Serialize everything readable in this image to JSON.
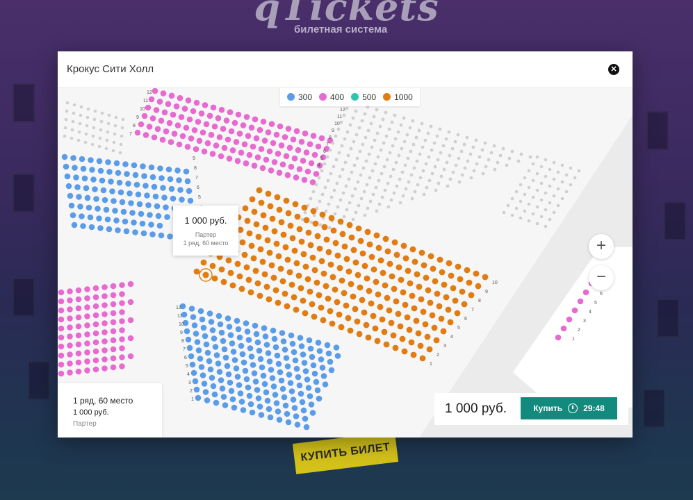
{
  "brand": {
    "logo_text": "qTickets",
    "subtitle": "билетная система"
  },
  "banner": {
    "label": "КУПИТЬ БИЛЕТ"
  },
  "modal": {
    "title": "Крокус Сити Холл",
    "close_icon": "close-icon"
  },
  "legend": [
    {
      "price": "300",
      "color": "#5a9ce8"
    },
    {
      "price": "400",
      "color": "#e86ad0"
    },
    {
      "price": "500",
      "color": "#2cc6ae"
    },
    {
      "price": "1000",
      "color": "#e07c12"
    }
  ],
  "tooltip": {
    "price": "1 000 руб.",
    "sector": "Партер",
    "seat": "1 ряд, 60 место"
  },
  "zoom": {
    "in_icon": "plus-icon",
    "out_icon": "minus-icon",
    "in_label": "+",
    "out_label": "−"
  },
  "selected": {
    "seat": "1 ряд, 60 место",
    "price": "1 000 руб.",
    "sector": "Партер"
  },
  "checkout": {
    "total": "1 000 руб.",
    "buy_label": "Купить",
    "timer": "29:48"
  },
  "seat_colors": {
    "empty": "#cfcfcf",
    "blue": "#5a9ce8",
    "pink": "#e86ad0",
    "orange": "#e07c12"
  }
}
